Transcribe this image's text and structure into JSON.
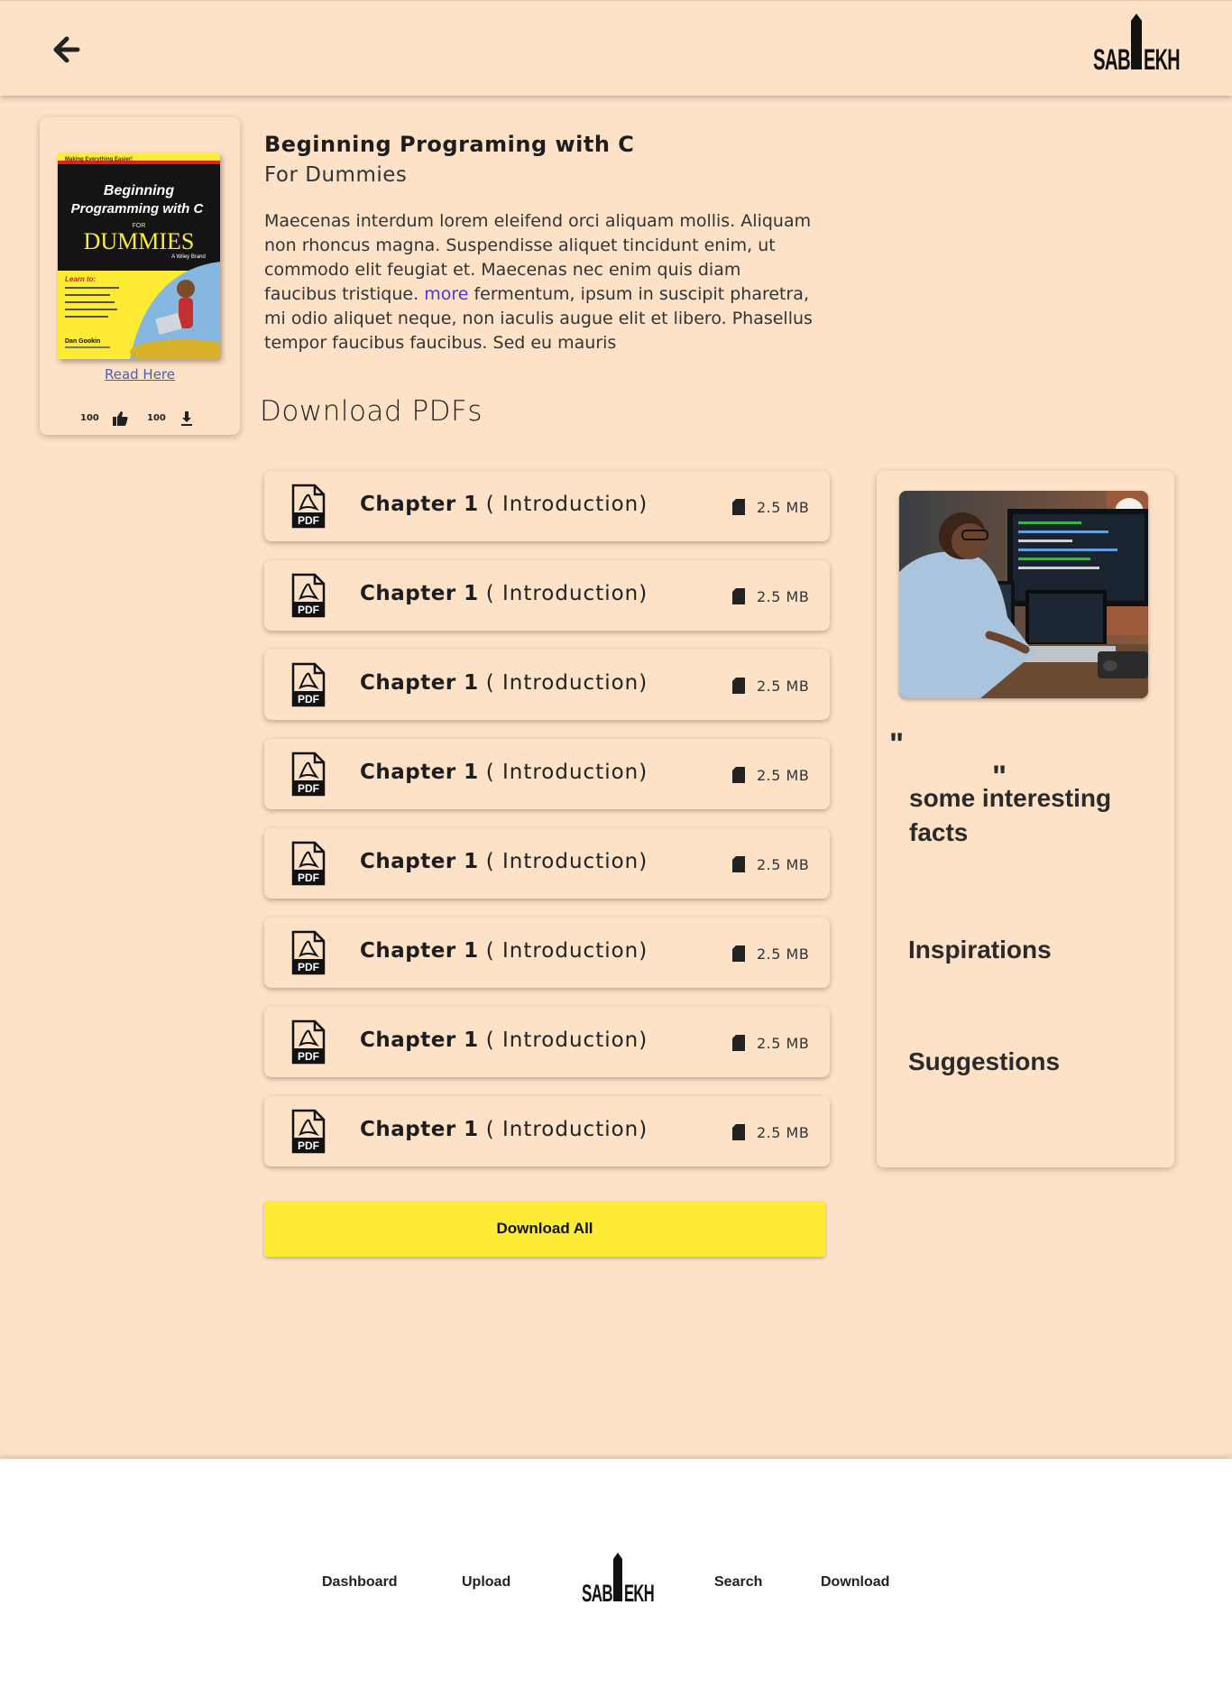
{
  "header": {
    "back_icon": "arrow-left-icon",
    "logo_text": "SABEKH"
  },
  "book": {
    "title": "Beginning Programing with C",
    "subtitle": "For Dummies",
    "description_before": "Maecenas interdum lorem eleifend orci aliquam mollis. Aliquam non rhoncus magna. Suspendisse aliquet tincidunt enim, ut commodo elit feugiat et. Maecenas nec enim quis diam faucibus tristique.",
    "more_link": "more",
    "description_after": "fermentum, ipsum in suscipit pharetra, mi odio aliquet neque, non iaculis augue elit et libero. Phasellus tempor faucibus faucibus. Sed eu mauris",
    "read_link": "Read Here",
    "likes": "100",
    "downloads": "100",
    "cover": {
      "tagline": "Making Everything Easier!",
      "title_line1": "Beginning",
      "title_line2": "Programming with C",
      "for_text": "FOR",
      "brand": "DUMMIES",
      "publisher": "A Wiley Brand",
      "learn_to": "Learn to:",
      "author": "Dan Gookin"
    }
  },
  "downloads": {
    "section_title": "Download PDFs",
    "chapters": [
      {
        "name": "Chapter 1",
        "sub": "( Introduction)",
        "size": "2.5 MB"
      },
      {
        "name": "Chapter 1",
        "sub": "( Introduction)",
        "size": "2.5 MB"
      },
      {
        "name": "Chapter 1",
        "sub": "( Introduction)",
        "size": "2.5 MB"
      },
      {
        "name": "Chapter 1",
        "sub": "( Introduction)",
        "size": "2.5 MB"
      },
      {
        "name": "Chapter 1",
        "sub": "( Introduction)",
        "size": "2.5 MB"
      },
      {
        "name": "Chapter 1",
        "sub": "( Introduction)",
        "size": "2.5 MB"
      },
      {
        "name": "Chapter 1",
        "sub": "( Introduction)",
        "size": "2.5 MB"
      },
      {
        "name": "Chapter 1",
        "sub": "( Introduction)",
        "size": "2.5 MB"
      }
    ],
    "download_all": "Download All"
  },
  "sidebar": {
    "quote_open": "\"",
    "quote": "some interesting facts",
    "quote_close": "\"",
    "inspirations": "Inspirations",
    "suggestions": "Suggestions"
  },
  "footer": {
    "nav": [
      "Dashboard",
      "Upload",
      "Search",
      "Download"
    ],
    "logo_text": "SABEKH"
  },
  "colors": {
    "background": "#fde2c8",
    "accent_button": "#fdeb35",
    "link": "#4a3ad8"
  }
}
